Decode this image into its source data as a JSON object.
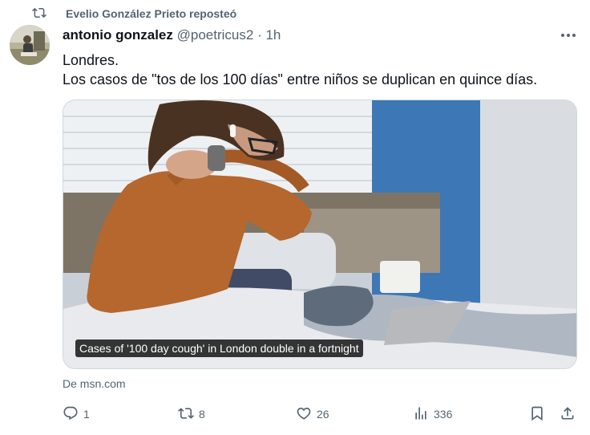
{
  "repost": {
    "text": "Evelio González Prieto reposteó"
  },
  "tweet": {
    "author_name": "antonio gonzalez",
    "handle": "@poetricus2",
    "separator": "·",
    "time": "1h",
    "lines": [
      "Londres.",
      "Los casos de \"tos de los 100 días\" entre niños se duplican en quince días."
    ]
  },
  "media": {
    "caption": "Cases of '100 day cough' in London double in a fortnight"
  },
  "source": {
    "text": "De msn.com"
  },
  "actions": {
    "replies": "1",
    "reposts": "8",
    "likes": "26",
    "views": "336"
  },
  "colors": {
    "text": "#0f1419",
    "muted": "#536471",
    "border": "#cfd9de"
  }
}
